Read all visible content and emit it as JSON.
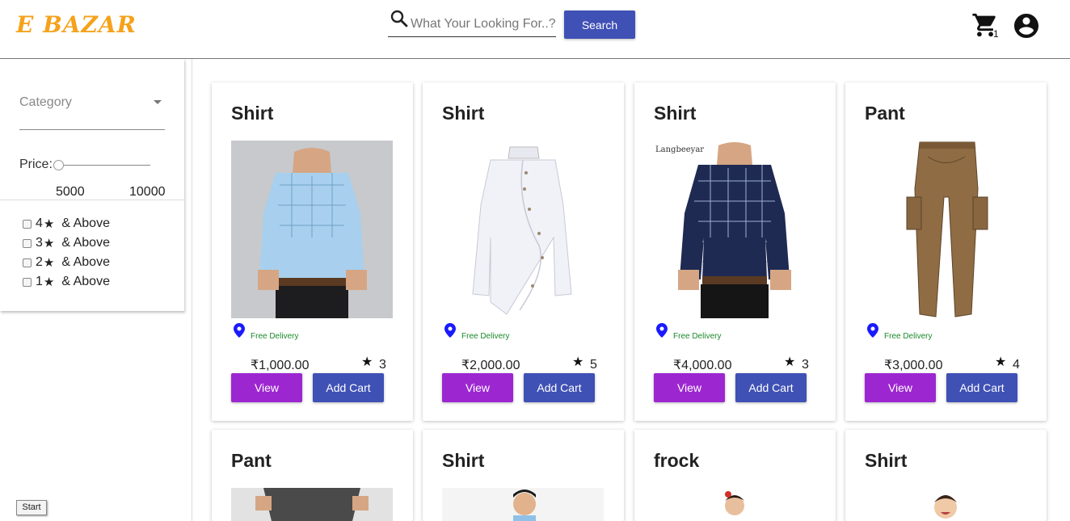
{
  "brand": {
    "logo_text": "E BAZAR",
    "color": "#f5a21b"
  },
  "search": {
    "placeholder": "What Your Looking For..?",
    "button_label": "Search"
  },
  "header": {
    "cart_count": "1",
    "cart_icon": "shopping-cart-icon",
    "account_icon": "account-circle-icon"
  },
  "sidebar": {
    "category_label": "Category",
    "price_label": "Price:",
    "price_min": "5000",
    "price_max": "10000",
    "ratings": [
      {
        "value": "4",
        "suffix": "& Above"
      },
      {
        "value": "3",
        "suffix": "& Above"
      },
      {
        "value": "2",
        "suffix": "& Above"
      },
      {
        "value": "1",
        "suffix": "& Above"
      }
    ]
  },
  "products": [
    {
      "title": "Shirt",
      "delivery": "Free Delivery",
      "price": "₹1,000.00",
      "rating": "3",
      "view_label": "View",
      "cart_label": "Add Cart"
    },
    {
      "title": "Shirt",
      "delivery": "Free Delivery",
      "price": "₹2,000.00",
      "rating": "5",
      "view_label": "View",
      "cart_label": "Add Cart"
    },
    {
      "title": "Shirt",
      "delivery": "Free Delivery",
      "price": "₹4,000.00",
      "rating": "3",
      "view_label": "View",
      "cart_label": "Add Cart",
      "image_watermark": "Langbeeyar"
    },
    {
      "title": "Pant",
      "delivery": "Free Delivery",
      "price": "₹3,000.00",
      "rating": "4",
      "view_label": "View",
      "cart_label": "Add Cart"
    },
    {
      "title": "Pant"
    },
    {
      "title": "Shirt"
    },
    {
      "title": "frock"
    },
    {
      "title": "Shirt"
    }
  ],
  "colors": {
    "primary": "#3f51b5",
    "view_button": "#9c27d0",
    "free_delivery": "#1b8a2b",
    "pin": "#1a1aff"
  },
  "taskbar": {
    "start_label": "Start"
  }
}
